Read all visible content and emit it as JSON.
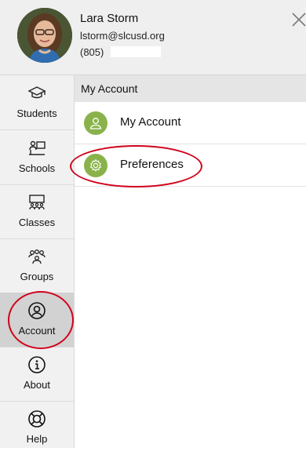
{
  "user": {
    "name": "Lara Storm",
    "email": "lstorm@slcusd.org",
    "phone_prefix": "(805)"
  },
  "sidebar": {
    "items": [
      {
        "label": "Students",
        "icon": "graduation-cap-icon"
      },
      {
        "label": "Schools",
        "icon": "school-icon"
      },
      {
        "label": "Classes",
        "icon": "classes-icon"
      },
      {
        "label": "Groups",
        "icon": "groups-icon"
      },
      {
        "label": "Account",
        "icon": "account-icon",
        "active": true
      },
      {
        "label": "About",
        "icon": "info-icon"
      },
      {
        "label": "Help",
        "icon": "lifebuoy-icon"
      }
    ]
  },
  "main": {
    "section_title": "My Account",
    "menu": [
      {
        "label": "My Account",
        "icon": "user-icon"
      },
      {
        "label": "Preferences",
        "icon": "gear-icon"
      }
    ]
  },
  "colors": {
    "accent_green": "#89b34a",
    "annotation_red": "#d0021b",
    "active_nav": "#d2d2d2"
  }
}
